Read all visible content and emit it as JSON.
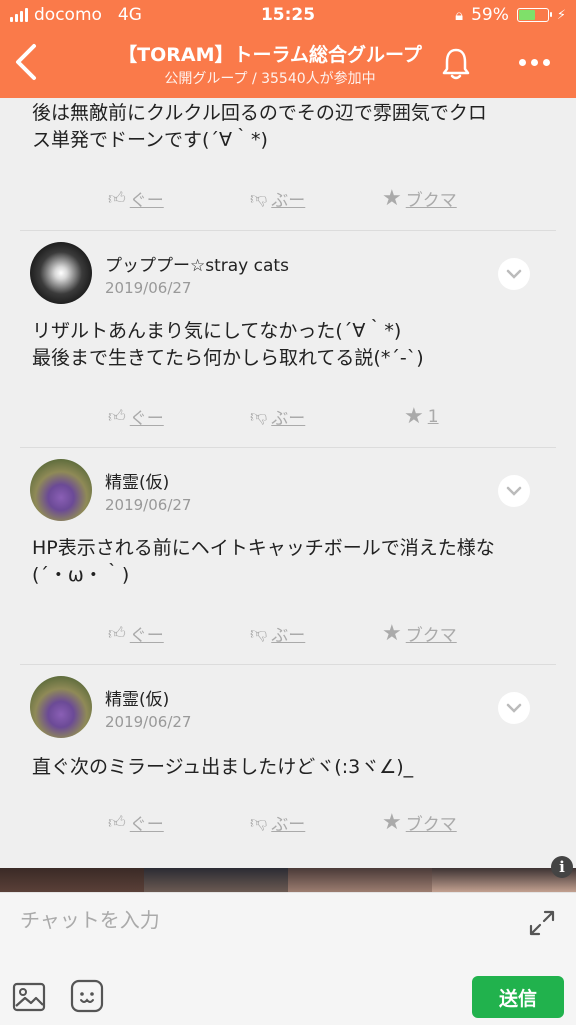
{
  "status": {
    "carrier": "docomo",
    "network": "4G",
    "time": "15:25",
    "battery": "59%",
    "battery_level": 0.59
  },
  "header": {
    "title": "【TORAM】トーラム総合グループ",
    "subtitle": "公開グループ / 35540人が参加中"
  },
  "first_post": {
    "body_lines": [
      "後は無敵前にクルクル回るのでその辺で雰囲気でクロ",
      "ス単発でドーンです(´∀｀*)"
    ]
  },
  "labels": {
    "like": "ぐー",
    "dislike": "ぶー",
    "bookmark": "ブクマ"
  },
  "posts": [
    {
      "author": "プッププー☆stray cats",
      "date": "2019/06/27",
      "body": "リザルトあんまり気にしてなかった(´∀｀*)\n最後まで生きてたら何かしら取れてる説(*´-`)",
      "bookmark": "1"
    },
    {
      "author": "精霊(仮)",
      "date": "2019/06/27",
      "body": "HP表示される前にヘイトキャッチボールで消えた様な\n(´・ω・｀)",
      "bookmark": "ブクマ"
    },
    {
      "author": "精霊(仮)",
      "date": "2019/06/27",
      "body": "直ぐ次のミラージュ出ましたけどヾ(:3ヾ∠)_",
      "bookmark": "ブクマ"
    }
  ],
  "input": {
    "placeholder": "チャットを入力",
    "send_label": "送信"
  },
  "colors": {
    "header": "#fa7a4a",
    "send": "#21b24d"
  }
}
